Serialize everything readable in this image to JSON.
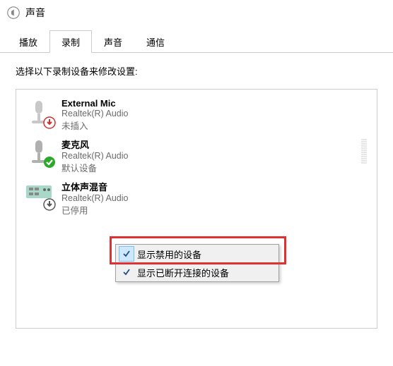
{
  "window": {
    "title": "声音"
  },
  "tabs": [
    {
      "label": "播放",
      "active": false
    },
    {
      "label": "录制",
      "active": true
    },
    {
      "label": "声音",
      "active": false
    },
    {
      "label": "通信",
      "active": false
    }
  ],
  "instruction": "选择以下录制设备来修改设置:",
  "devices": [
    {
      "name": "External Mic",
      "driver": "Realtek(R) Audio",
      "status": "未插入",
      "badge": "down-red",
      "meter": false
    },
    {
      "name": "麦克风",
      "driver": "Realtek(R) Audio",
      "status": "默认设备",
      "badge": "check-green",
      "meter": true
    },
    {
      "name": "立体声混音",
      "driver": "Realtek(R) Audio",
      "status": "已停用",
      "badge": "down-gray",
      "meter": false
    }
  ],
  "context_menu": [
    {
      "label": "显示禁用的设备",
      "checked": true
    },
    {
      "label": "显示已断开连接的设备",
      "checked": true
    }
  ],
  "colors": {
    "highlight_border": "#e03030",
    "menu_check_bg": "#cde8ff"
  }
}
